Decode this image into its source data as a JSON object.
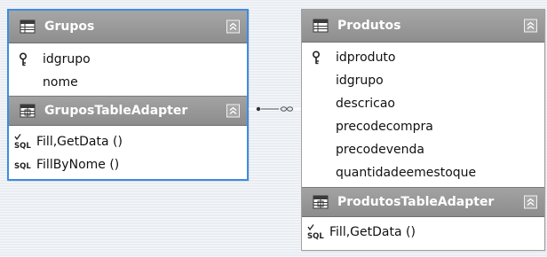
{
  "grupos": {
    "title": "Grupos",
    "columns": [
      {
        "name": "idgrupo",
        "is_key": true
      },
      {
        "name": "nome",
        "is_key": false
      }
    ],
    "adapter": {
      "title": "GruposTableAdapter",
      "methods": [
        {
          "name": "Fill,GetData ()",
          "icon": "sql-check-icon"
        },
        {
          "name": "FillByNome ()",
          "icon": "sql-icon"
        }
      ]
    }
  },
  "produtos": {
    "title": "Produtos",
    "columns": [
      {
        "name": "idproduto",
        "is_key": true
      },
      {
        "name": "idgrupo",
        "is_key": false
      },
      {
        "name": "descricao",
        "is_key": false
      },
      {
        "name": "precodecompra",
        "is_key": false
      },
      {
        "name": "precodevenda",
        "is_key": false
      },
      {
        "name": "quantidadeemestoque",
        "is_key": false
      }
    ],
    "adapter": {
      "title": "ProdutosTableAdapter",
      "methods": [
        {
          "name": "Fill,GetData ()",
          "icon": "sql-check-icon"
        }
      ]
    }
  },
  "icons": {
    "table": "datatable-icon",
    "adapter": "table-adapter-icon",
    "collapse": "collapse-chevron-icon",
    "key": "primary-key-icon",
    "relation": "relation-connector"
  },
  "colors": {
    "selection_border": "#3e8be3",
    "header_gray": "#999999",
    "canvas": "#e9edf2"
  }
}
